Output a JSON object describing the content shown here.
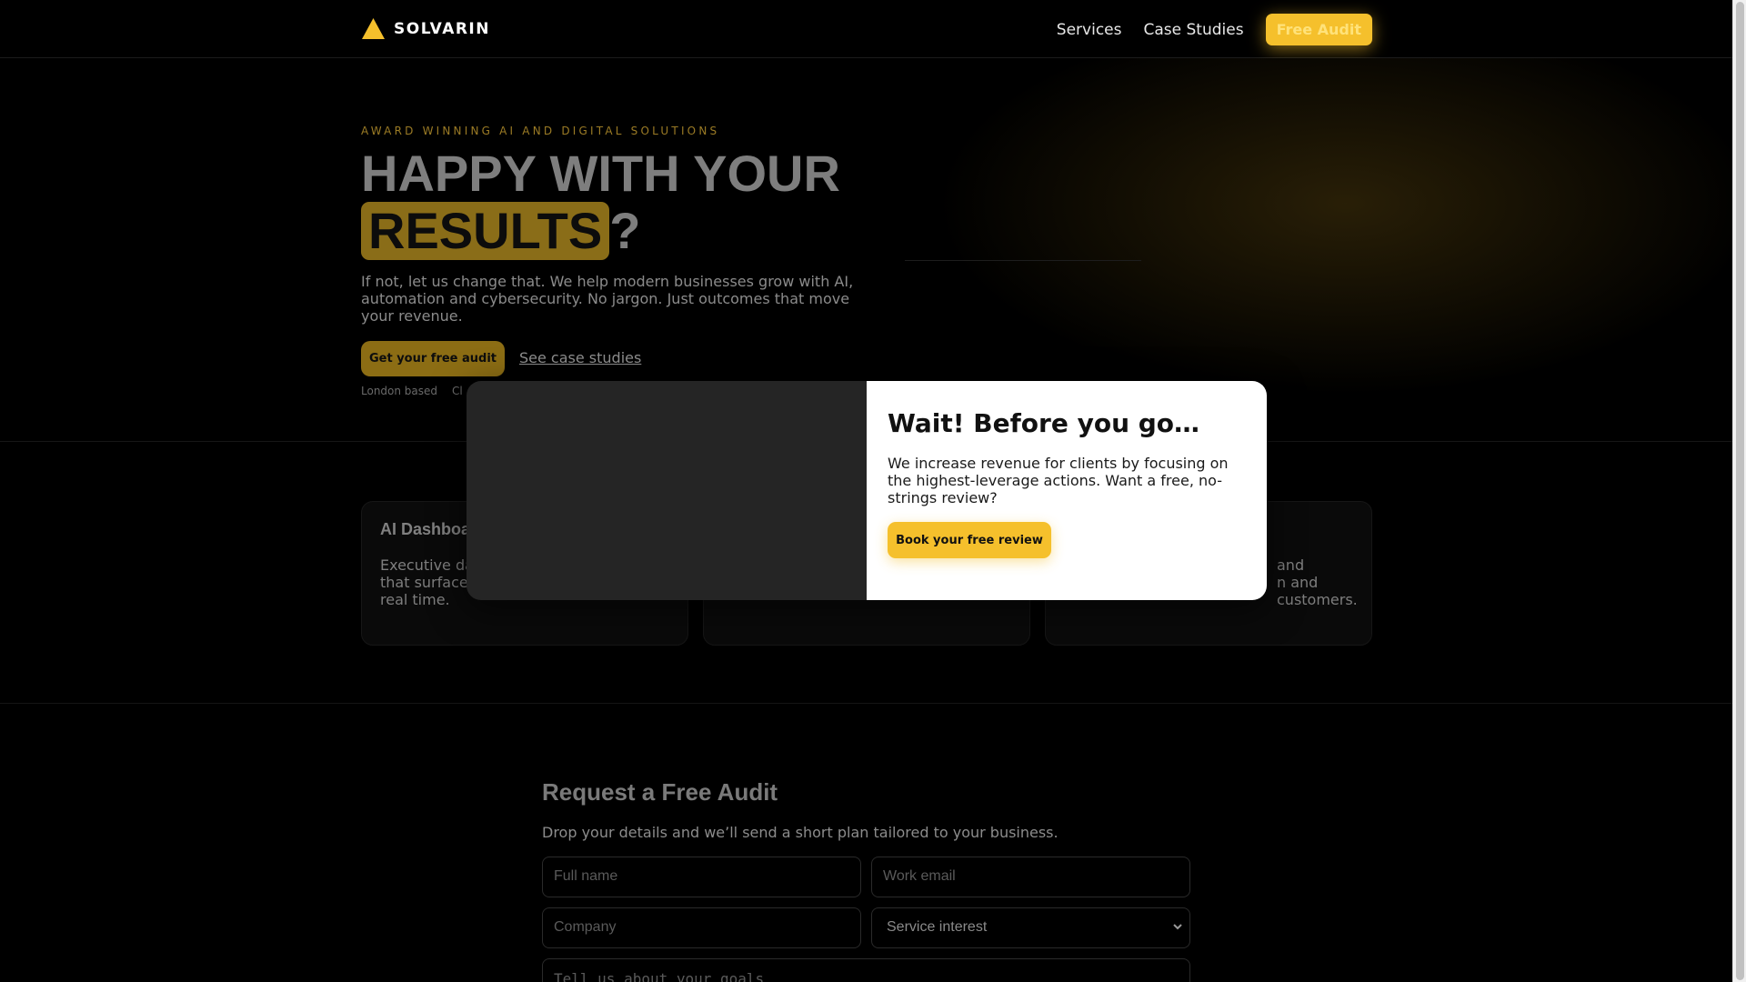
{
  "header": {
    "brand": "SOLVARIN",
    "nav": {
      "services": "Services",
      "case_studies": "Case Studies",
      "cta": "Free Audit"
    }
  },
  "hero": {
    "eyebrow": "AWARD WINNING AI AND DIGITAL SOLUTIONS",
    "title_line1": "HAPPY WITH YOUR",
    "title_highlight": "RESULTS",
    "title_suffix": "?",
    "subtitle": "If not, let us change that. We help modern businesses grow with AI, automation and cybersecurity. No jargon. Just outcomes that move your revenue.",
    "primary_cta": "Get your free audit",
    "secondary_link": "See case studies",
    "meta": [
      "London based",
      "Cl"
    ]
  },
  "services": [
    {
      "title": "AI Dashboa",
      "desc": "Executive da\nthat surface\nreal time."
    },
    {
      "title": "",
      "desc": ""
    },
    {
      "title": "",
      "desc": "and\nn and\ncustomers."
    }
  ],
  "form": {
    "title": "Request a Free Audit",
    "subtitle": "Drop your details and we’ll send a short plan tailored to your business.",
    "name_placeholder": "Full name",
    "email_placeholder": "Work email",
    "company_placeholder": "Company",
    "service_select": "Service interest",
    "goals_placeholder": "Tell us about your goals"
  },
  "modal": {
    "title": "Wait! Before you go…",
    "text": "We increase revenue for clients by focusing on the highest-leverage actions. Want a free, no-strings review?",
    "button": "Book your free review"
  },
  "colors": {
    "accent": "#f5c02c",
    "background": "#000000",
    "modal_background": "#ffffff"
  }
}
